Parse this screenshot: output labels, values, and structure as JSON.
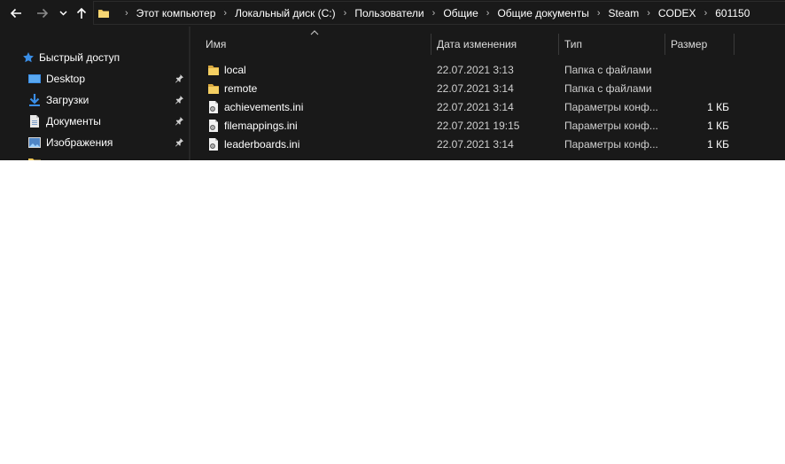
{
  "address": {
    "crumbs": [
      "Этот компьютер",
      "Локальный диск (C:)",
      "Пользователи",
      "Общие",
      "Общие документы",
      "Steam",
      "CODEX",
      "601150"
    ]
  },
  "nav": {
    "quick_access": "Быстрый доступ",
    "items": [
      {
        "label": "Desktop",
        "icon": "desktop-icon",
        "pinned": true
      },
      {
        "label": "Загрузки",
        "icon": "download-icon",
        "pinned": true
      },
      {
        "label": "Документы",
        "icon": "documents-icon",
        "pinned": true
      },
      {
        "label": "Изображения",
        "icon": "pictures-icon",
        "pinned": true
      }
    ]
  },
  "columns": {
    "name": "Имя",
    "date": "Дата изменения",
    "type": "Тип",
    "size": "Размер"
  },
  "files": [
    {
      "name": "local",
      "date": "22.07.2021 3:13",
      "type": "Папка с файлами",
      "size": "",
      "kind": "folder"
    },
    {
      "name": "remote",
      "date": "22.07.2021 3:14",
      "type": "Папка с файлами",
      "size": "",
      "kind": "folder"
    },
    {
      "name": "achievements.ini",
      "date": "22.07.2021 3:14",
      "type": "Параметры конф...",
      "size": "1 КБ",
      "kind": "ini"
    },
    {
      "name": "filemappings.ini",
      "date": "22.07.2021 19:15",
      "type": "Параметры конф...",
      "size": "1 КБ",
      "kind": "ini"
    },
    {
      "name": "leaderboards.ini",
      "date": "22.07.2021 3:14",
      "type": "Параметры конф...",
      "size": "1 КБ",
      "kind": "ini"
    }
  ],
  "colors": {
    "background": "#191919",
    "folder": "#f0c85a",
    "accent": "#3a8ee6"
  }
}
